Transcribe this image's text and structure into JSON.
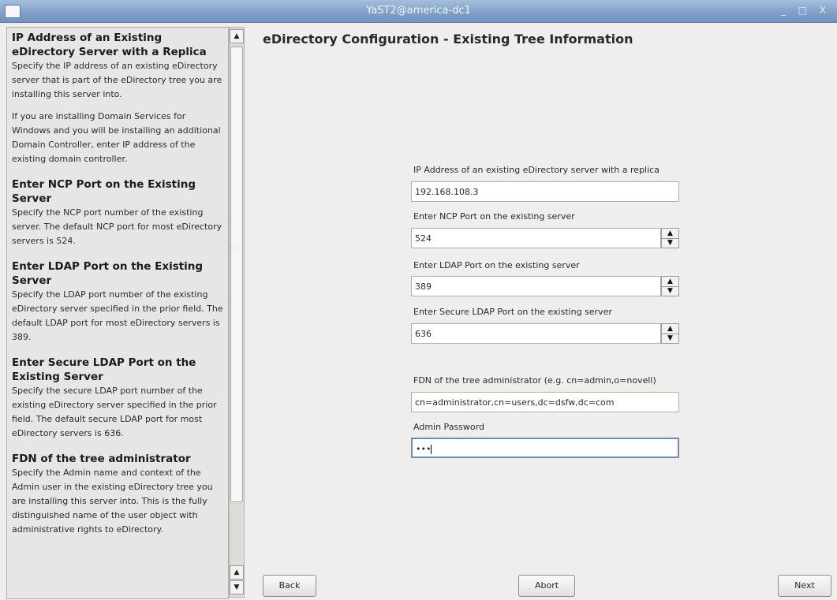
{
  "window": {
    "title": "YaST2@america-dc1",
    "controls": "_ □ X"
  },
  "help": {
    "sections": [
      {
        "title": "IP Address of an Existing eDirectory Server with a Replica",
        "paragraphs": [
          "Specify the IP address of an existing eDirectory server that is part of the eDirectory tree you are installing this server into.",
          "If you are installing Domain Services for Windows and you will be installing an additional Domain Controller, enter IP address of the existing domain controller."
        ]
      },
      {
        "title": "Enter NCP Port on the Existing Server",
        "paragraphs": [
          "Specify the NCP port number of the existing server. The default NCP port for most eDirectory servers is 524."
        ]
      },
      {
        "title": "Enter LDAP Port on the Existing Server",
        "paragraphs": [
          "Specify the LDAP port number of the existing eDirectory server specified in the prior field. The default LDAP port for most eDirectory servers is 389."
        ]
      },
      {
        "title": "Enter Secure LDAP Port on the Existing Server",
        "paragraphs": [
          "Specify the secure LDAP port number of the existing eDirectory server specified in the prior field. The default secure LDAP port for most eDirectory servers is 636."
        ]
      },
      {
        "title": "FDN of the tree administrator",
        "paragraphs": [
          "Specify the Admin name and context of the Admin user in the existing eDirectory tree you are installing this server into. This is the fully distinguished name of the user object with administrative rights to eDirectory."
        ]
      }
    ]
  },
  "scrollbar": {
    "up_icon": "▲",
    "down_icon": "▼",
    "grip": "⋮⋮⋮"
  },
  "main": {
    "title": "eDirectory Configuration - Existing Tree Information",
    "fields": {
      "ip": {
        "label": "IP Address of an existing eDirectory server with a replica",
        "value": "192.168.108.3"
      },
      "ncp": {
        "label": "Enter NCP Port on the existing server",
        "value": "524"
      },
      "ldap": {
        "label": "Enter LDAP Port on the existing server",
        "value": "389"
      },
      "sldap": {
        "label": "Enter Secure LDAP Port on the existing server",
        "value": "636"
      },
      "fdn": {
        "label": "FDN of the tree administrator (e.g. cn=admin,o=novell)",
        "value": "cn=administrator,cn=users,dc=dsfw,dc=com"
      },
      "password": {
        "label": "Admin Password",
        "value": "•••"
      }
    },
    "spin_up": "▲",
    "spin_down": "▼"
  },
  "buttons": {
    "back": "Back",
    "abort": "Abort",
    "next": "Next"
  }
}
